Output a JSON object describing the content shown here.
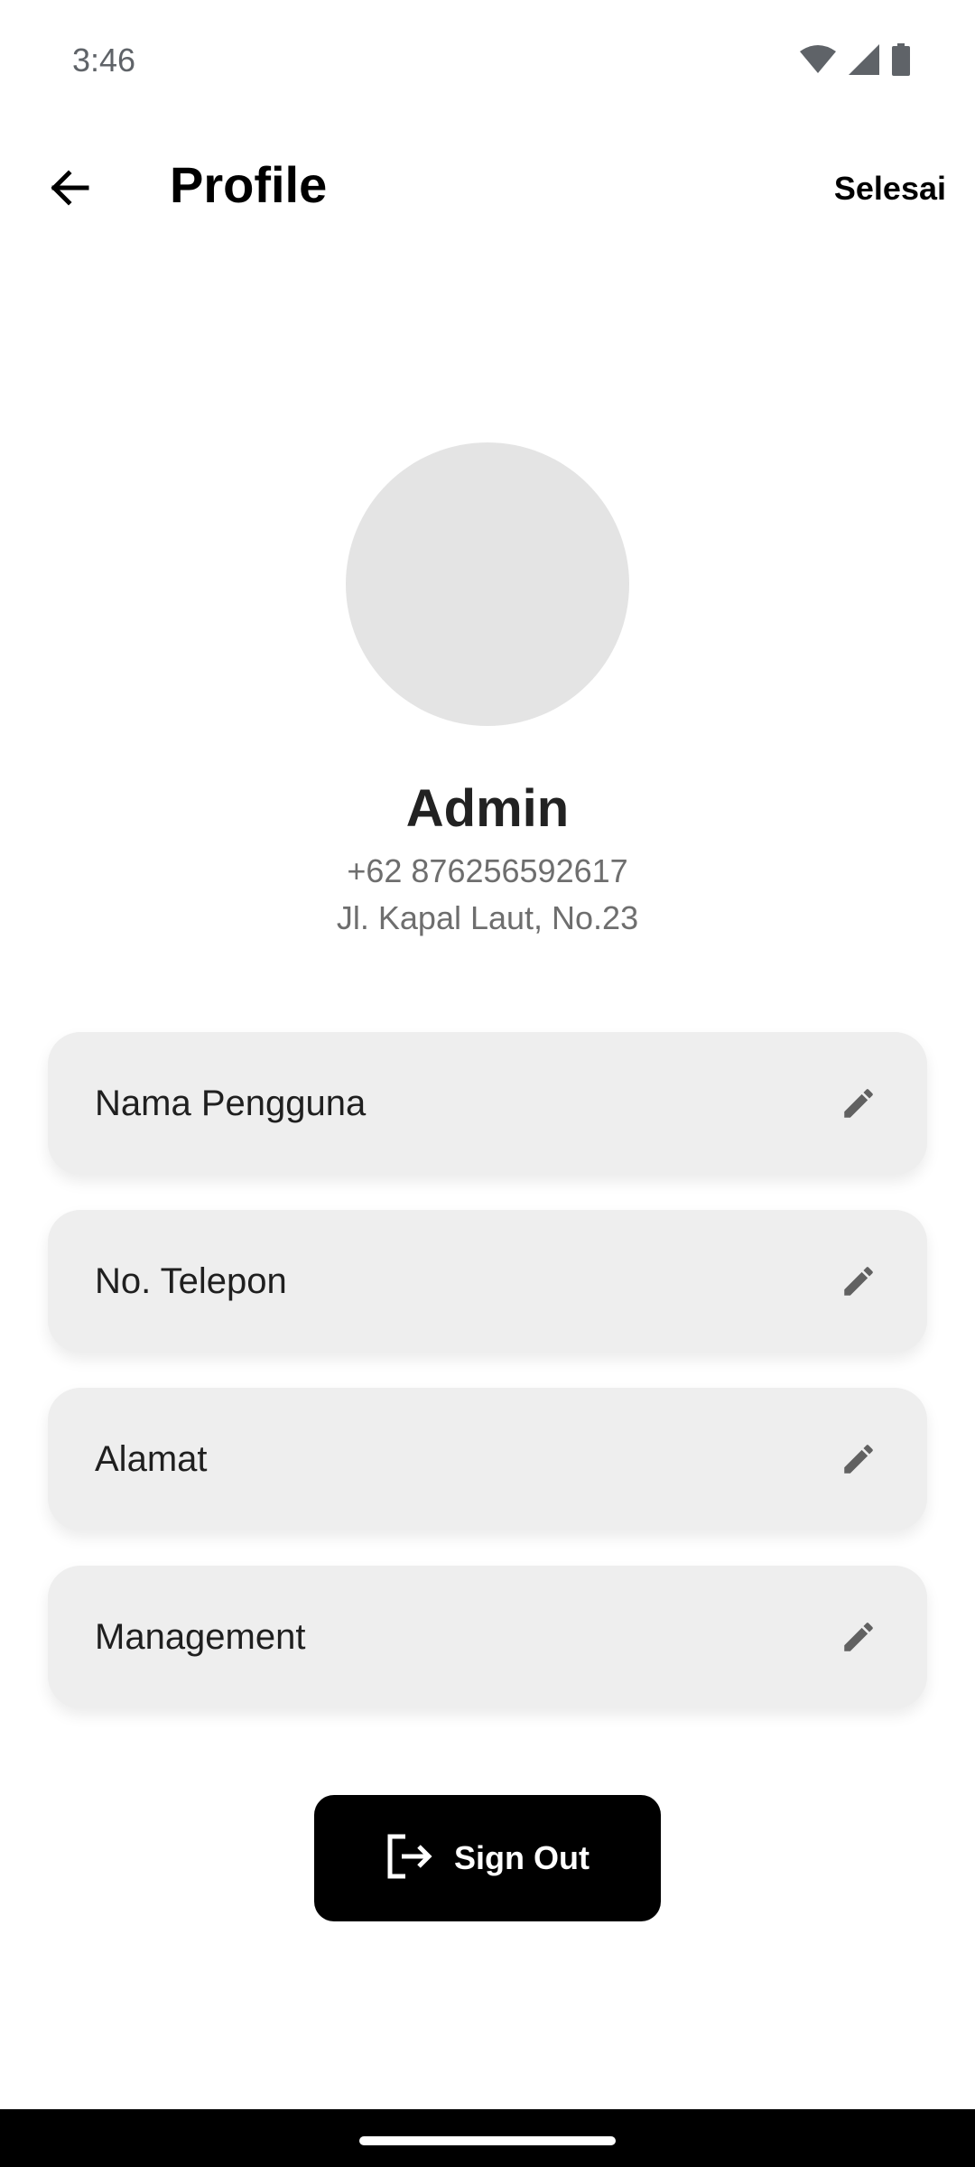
{
  "status_bar": {
    "time": "3:46",
    "icons": [
      "wifi-icon",
      "signal-icon",
      "battery-icon"
    ]
  },
  "app_bar": {
    "back_icon": "arrow-left-icon",
    "title": "Profile",
    "done_label": "Selesai"
  },
  "profile": {
    "name": "Admin",
    "phone": "+62 876256592617",
    "address": "Jl. Kapal Laut, No.23"
  },
  "fields": [
    {
      "label": "Nama Pengguna",
      "icon": "pencil-icon"
    },
    {
      "label": "No. Telepon",
      "icon": "pencil-icon"
    },
    {
      "label": "Alamat",
      "icon": "pencil-icon"
    },
    {
      "label": "Management",
      "icon": "pencil-icon"
    }
  ],
  "sign_out": {
    "label": "Sign Out",
    "icon": "logout-icon"
  },
  "colors": {
    "card_background": "#eeeeee",
    "avatar_placeholder": "#e4e4e4",
    "button_background": "#000000",
    "secondary_text": "#6e6e6e"
  }
}
